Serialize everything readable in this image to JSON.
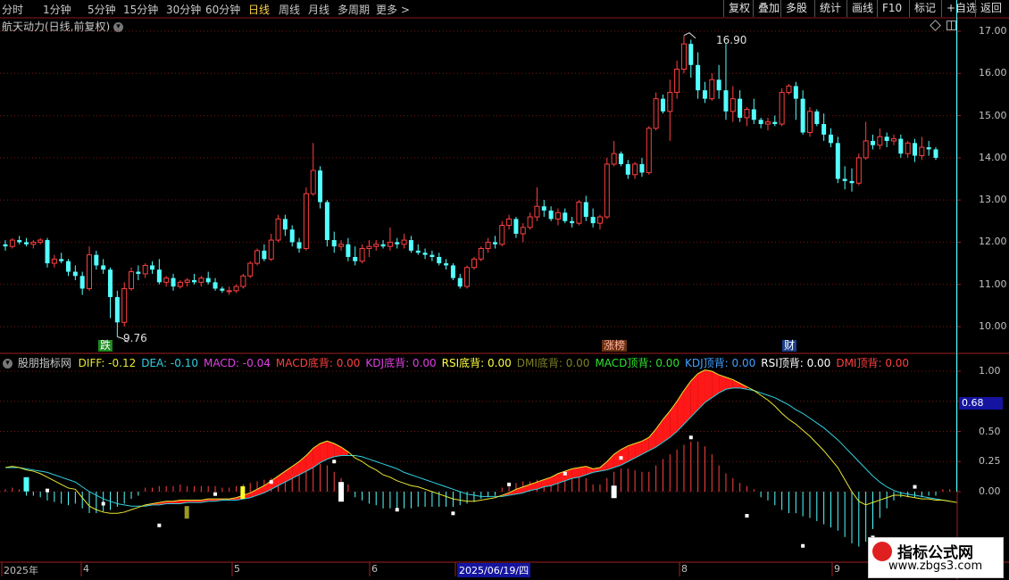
{
  "toolbar": {
    "periods": [
      "分时",
      "1分钟",
      "5分钟",
      "15分钟",
      "30分钟",
      "60分钟",
      "日线",
      "周线",
      "月线",
      "多周期",
      "更多 >"
    ],
    "active_period": "日线",
    "right_buttons": [
      "复权",
      "叠加",
      "多股",
      "统计",
      "画线",
      "F10",
      "标记",
      "+自选",
      "返回"
    ]
  },
  "title": "航天动力(日线,前复权)",
  "price_axis": [
    "17.00",
    "16.00",
    "15.00",
    "14.00",
    "13.00",
    "12.00",
    "11.00",
    "10.00"
  ],
  "high_label": "16.90",
  "low_label": "9.76",
  "markers": [
    {
      "text": "跌",
      "color": "#30c030"
    },
    {
      "text": "涨榜",
      "color": "#e03030"
    },
    {
      "text": "财",
      "color": "#4090ff"
    }
  ],
  "indicator": {
    "name": "股朋指标网",
    "values": [
      {
        "label": "DIFF:",
        "value": "-0.12",
        "color": "#e8e830"
      },
      {
        "label": "DEA:",
        "value": "-0.10",
        "color": "#30d0e0"
      },
      {
        "label": "MACD:",
        "value": "-0.04",
        "color": "#e040e0"
      },
      {
        "label": "MACD底背:",
        "value": "0.00",
        "color": "#ff4040"
      },
      {
        "label": "KDJ底背:",
        "value": "0.00",
        "color": "#e040e0"
      },
      {
        "label": "RSI底背:",
        "value": "0.00",
        "color": "#ffff40"
      },
      {
        "label": "DMI底背:",
        "value": "0.00",
        "color": "#808020"
      },
      {
        "label": "MACD顶背:",
        "value": "0.00",
        "color": "#30e030"
      },
      {
        "label": "KDJ顶背:",
        "value": "0.00",
        "color": "#40a0ff"
      },
      {
        "label": "RSI顶背:",
        "value": "0.00",
        "color": "#ffffff"
      },
      {
        "label": "DMI顶背:",
        "value": "0.00",
        "color": "#ff4040"
      }
    ]
  },
  "indicator_axis": [
    "1.00",
    "0.75",
    "0.50",
    "0.25",
    "0.00"
  ],
  "current_value": "0.68",
  "date_axis": [
    "2025年",
    "4",
    "5",
    "6",
    "2025/06/19/四",
    "8",
    "9"
  ],
  "watermark": {
    "title": "指标公式网",
    "url": "www.zbgs3.com"
  },
  "chart_data": {
    "type": "candlestick",
    "title": "航天动力(日线,前复权)",
    "ylim": [
      9.7,
      17.3
    ],
    "ohlc": [
      [
        11.95,
        12.05,
        11.8,
        11.9
      ],
      [
        11.9,
        12.1,
        11.85,
        12.05
      ],
      [
        12.05,
        12.15,
        11.95,
        12.0
      ],
      [
        12.0,
        12.1,
        11.9,
        11.95
      ],
      [
        11.95,
        12.05,
        11.85,
        12.0
      ],
      [
        12.0,
        12.1,
        11.95,
        12.05
      ],
      [
        12.05,
        12.1,
        11.4,
        11.5
      ],
      [
        11.5,
        11.7,
        11.4,
        11.6
      ],
      [
        11.6,
        11.75,
        11.5,
        11.55
      ],
      [
        11.55,
        11.6,
        11.2,
        11.3
      ],
      [
        11.3,
        11.45,
        11.1,
        11.2
      ],
      [
        11.2,
        11.3,
        10.75,
        10.9
      ],
      [
        10.9,
        11.9,
        10.85,
        11.7
      ],
      [
        11.7,
        11.8,
        11.35,
        11.45
      ],
      [
        11.45,
        11.6,
        11.25,
        11.35
      ],
      [
        11.35,
        11.4,
        10.2,
        10.7
      ],
      [
        10.7,
        10.85,
        9.76,
        10.1
      ],
      [
        10.1,
        11.05,
        10.0,
        10.9
      ],
      [
        10.9,
        11.4,
        10.85,
        11.3
      ],
      [
        11.3,
        11.45,
        11.1,
        11.25
      ],
      [
        11.25,
        11.5,
        11.15,
        11.45
      ],
      [
        11.45,
        11.55,
        11.25,
        11.35
      ],
      [
        11.35,
        11.6,
        11.0,
        11.05
      ],
      [
        11.05,
        11.2,
        10.95,
        11.15
      ],
      [
        11.15,
        11.25,
        10.85,
        10.95
      ],
      [
        10.95,
        11.1,
        10.9,
        11.05
      ],
      [
        11.05,
        11.15,
        10.95,
        11.1
      ],
      [
        11.1,
        11.25,
        11.0,
        11.05
      ],
      [
        11.05,
        11.2,
        10.95,
        11.15
      ],
      [
        11.15,
        11.3,
        11.0,
        11.05
      ],
      [
        11.05,
        11.15,
        10.85,
        10.9
      ],
      [
        10.9,
        10.95,
        10.8,
        10.85
      ],
      [
        10.85,
        10.95,
        10.75,
        10.85
      ],
      [
        10.85,
        11.0,
        10.8,
        10.95
      ],
      [
        10.95,
        11.25,
        10.9,
        11.2
      ],
      [
        11.2,
        11.55,
        11.15,
        11.5
      ],
      [
        11.5,
        11.85,
        11.45,
        11.8
      ],
      [
        11.8,
        11.95,
        11.55,
        11.6
      ],
      [
        11.6,
        12.2,
        11.55,
        12.05
      ],
      [
        12.05,
        12.65,
        12.0,
        12.55
      ],
      [
        12.55,
        12.65,
        12.15,
        12.3
      ],
      [
        12.3,
        12.4,
        11.9,
        12.0
      ],
      [
        12.0,
        12.1,
        11.75,
        11.85
      ],
      [
        11.85,
        13.3,
        11.8,
        13.15
      ],
      [
        13.15,
        14.35,
        13.1,
        13.7
      ],
      [
        13.7,
        13.8,
        12.8,
        12.95
      ],
      [
        12.95,
        13.0,
        11.9,
        12.05
      ],
      [
        12.05,
        12.25,
        11.75,
        11.9
      ],
      [
        11.9,
        12.05,
        11.8,
        11.95
      ],
      [
        11.95,
        12.1,
        11.55,
        11.65
      ],
      [
        11.65,
        11.9,
        11.45,
        11.55
      ],
      [
        11.55,
        11.95,
        11.5,
        11.85
      ],
      [
        11.85,
        12.05,
        11.65,
        11.9
      ],
      [
        11.9,
        12.05,
        11.8,
        11.95
      ],
      [
        11.95,
        12.05,
        11.85,
        11.9
      ],
      [
        11.9,
        12.35,
        11.8,
        12.0
      ],
      [
        12.0,
        12.1,
        11.85,
        11.95
      ],
      [
        11.95,
        12.2,
        11.85,
        12.05
      ],
      [
        12.05,
        12.15,
        11.75,
        11.8
      ],
      [
        11.8,
        11.95,
        11.7,
        11.75
      ],
      [
        11.75,
        11.85,
        11.6,
        11.7
      ],
      [
        11.7,
        11.8,
        11.55,
        11.65
      ],
      [
        11.65,
        11.75,
        11.45,
        11.5
      ],
      [
        11.5,
        11.6,
        11.35,
        11.45
      ],
      [
        11.45,
        11.5,
        11.1,
        11.15
      ],
      [
        11.15,
        11.25,
        10.9,
        10.95
      ],
      [
        10.95,
        11.45,
        10.9,
        11.4
      ],
      [
        11.4,
        11.65,
        11.35,
        11.6
      ],
      [
        11.6,
        11.9,
        11.55,
        11.85
      ],
      [
        11.85,
        12.1,
        11.75,
        12.0
      ],
      [
        12.0,
        12.15,
        11.85,
        11.95
      ],
      [
        11.95,
        12.5,
        11.9,
        12.4
      ],
      [
        12.4,
        12.65,
        12.3,
        12.55
      ],
      [
        12.55,
        12.6,
        12.1,
        12.2
      ],
      [
        12.2,
        12.45,
        12.0,
        12.35
      ],
      [
        12.35,
        12.7,
        12.3,
        12.6
      ],
      [
        12.6,
        13.3,
        12.5,
        12.85
      ],
      [
        12.85,
        13.0,
        12.6,
        12.75
      ],
      [
        12.75,
        12.85,
        12.5,
        12.55
      ],
      [
        12.55,
        12.8,
        12.4,
        12.7
      ],
      [
        12.7,
        12.8,
        12.45,
        12.5
      ],
      [
        12.5,
        12.6,
        12.35,
        12.45
      ],
      [
        12.45,
        13.0,
        12.4,
        12.95
      ],
      [
        12.95,
        13.1,
        12.5,
        12.6
      ],
      [
        12.6,
        12.8,
        12.35,
        12.45
      ],
      [
        12.45,
        12.65,
        12.3,
        12.6
      ],
      [
        12.6,
        14.0,
        12.55,
        13.85
      ],
      [
        13.85,
        14.4,
        13.8,
        14.1
      ],
      [
        14.1,
        14.15,
        13.8,
        13.85
      ],
      [
        13.85,
        13.95,
        13.5,
        13.6
      ],
      [
        13.6,
        13.9,
        13.5,
        13.85
      ],
      [
        13.85,
        14.0,
        13.55,
        13.65
      ],
      [
        13.65,
        14.75,
        13.6,
        14.7
      ],
      [
        14.7,
        15.55,
        14.65,
        15.4
      ],
      [
        15.4,
        15.5,
        15.05,
        15.1
      ],
      [
        15.1,
        15.85,
        14.4,
        15.55
      ],
      [
        15.55,
        16.3,
        15.4,
        16.1
      ],
      [
        16.1,
        16.9,
        16.0,
        16.7
      ],
      [
        16.7,
        16.8,
        15.9,
        16.2
      ],
      [
        16.2,
        16.5,
        15.4,
        15.6
      ],
      [
        15.6,
        15.8,
        15.3,
        15.4
      ],
      [
        15.4,
        16.0,
        15.35,
        15.85
      ],
      [
        15.85,
        16.2,
        15.4,
        15.6
      ],
      [
        15.6,
        16.7,
        14.9,
        15.1
      ],
      [
        15.1,
        15.7,
        14.85,
        15.4
      ],
      [
        15.4,
        15.6,
        14.85,
        14.95
      ],
      [
        14.95,
        15.2,
        14.75,
        15.15
      ],
      [
        15.15,
        15.4,
        14.8,
        14.9
      ],
      [
        14.9,
        14.95,
        14.7,
        14.8
      ],
      [
        14.8,
        14.95,
        14.65,
        14.85
      ],
      [
        14.85,
        15.0,
        14.75,
        14.8
      ],
      [
        14.8,
        15.65,
        14.75,
        15.55
      ],
      [
        15.55,
        15.75,
        15.5,
        15.7
      ],
      [
        15.7,
        15.8,
        14.9,
        15.4
      ],
      [
        15.4,
        15.6,
        14.55,
        14.6
      ],
      [
        14.6,
        15.2,
        14.5,
        15.1
      ],
      [
        15.1,
        15.15,
        14.75,
        14.8
      ],
      [
        14.8,
        15.05,
        14.4,
        14.55
      ],
      [
        14.55,
        14.7,
        14.25,
        14.35
      ],
      [
        14.35,
        14.5,
        13.4,
        13.5
      ],
      [
        13.5,
        13.8,
        13.25,
        13.45
      ],
      [
        13.45,
        13.75,
        13.2,
        13.4
      ],
      [
        13.4,
        14.1,
        13.35,
        14.0
      ],
      [
        14.0,
        14.85,
        13.95,
        14.4
      ],
      [
        14.4,
        14.55,
        14.2,
        14.3
      ],
      [
        14.3,
        14.7,
        14.2,
        14.5
      ],
      [
        14.5,
        14.6,
        14.25,
        14.4
      ],
      [
        14.4,
        14.55,
        14.3,
        14.45
      ],
      [
        14.45,
        14.55,
        14.0,
        14.1
      ],
      [
        14.1,
        14.4,
        14.0,
        14.35
      ],
      [
        14.35,
        14.45,
        13.9,
        14.05
      ],
      [
        14.05,
        14.5,
        13.95,
        14.25
      ],
      [
        14.25,
        14.4,
        14.05,
        14.2
      ],
      [
        14.2,
        14.25,
        13.95,
        14.0
      ]
    ],
    "macd": {
      "ylim": [
        -0.55,
        1.15
      ],
      "diff": [
        0.2,
        0.21,
        0.2,
        0.18,
        0.17,
        0.15,
        0.12,
        0.09,
        0.06,
        0.03,
        0.02,
        -0.05,
        -0.12,
        -0.15,
        -0.17,
        -0.18,
        -0.18,
        -0.17,
        -0.15,
        -0.13,
        -0.11,
        -0.1,
        -0.09,
        -0.08,
        -0.08,
        -0.07,
        -0.07,
        -0.07,
        -0.07,
        -0.06,
        -0.06,
        -0.06,
        -0.06,
        -0.05,
        -0.03,
        -0.01,
        0.02,
        0.05,
        0.09,
        0.13,
        0.17,
        0.21,
        0.25,
        0.3,
        0.36,
        0.4,
        0.42,
        0.4,
        0.37,
        0.33,
        0.28,
        0.25,
        0.21,
        0.18,
        0.14,
        0.12,
        0.09,
        0.07,
        0.05,
        0.04,
        0.02,
        0.0,
        -0.02,
        -0.04,
        -0.06,
        -0.07,
        -0.08,
        -0.08,
        -0.07,
        -0.06,
        -0.05,
        -0.03,
        -0.01,
        0.02,
        0.04,
        0.06,
        0.08,
        0.1,
        0.12,
        0.15,
        0.17,
        0.19,
        0.2,
        0.21,
        0.19,
        0.2,
        0.25,
        0.31,
        0.35,
        0.38,
        0.4,
        0.42,
        0.45,
        0.52,
        0.6,
        0.67,
        0.75,
        0.84,
        0.92,
        0.98,
        1.01,
        1.0,
        0.97,
        0.95,
        0.93,
        0.9,
        0.87,
        0.84,
        0.8,
        0.76,
        0.71,
        0.65,
        0.6,
        0.56,
        0.51,
        0.46,
        0.4,
        0.34,
        0.27,
        0.2,
        0.1,
        0.0,
        -0.08,
        -0.11,
        -0.09,
        -0.07,
        -0.05,
        -0.03,
        -0.03,
        -0.04,
        -0.05,
        -0.06,
        -0.06,
        -0.07,
        -0.07,
        -0.08,
        -0.09
      ],
      "dea": [
        0.2,
        0.2,
        0.2,
        0.19,
        0.18,
        0.17,
        0.16,
        0.14,
        0.12,
        0.1,
        0.08,
        0.04,
        0.0,
        -0.03,
        -0.06,
        -0.08,
        -0.1,
        -0.11,
        -0.12,
        -0.12,
        -0.12,
        -0.11,
        -0.11,
        -0.1,
        -0.1,
        -0.1,
        -0.09,
        -0.09,
        -0.09,
        -0.08,
        -0.08,
        -0.07,
        -0.07,
        -0.07,
        -0.06,
        -0.05,
        -0.03,
        -0.01,
        0.02,
        0.05,
        0.08,
        0.11,
        0.14,
        0.17,
        0.2,
        0.24,
        0.27,
        0.29,
        0.3,
        0.3,
        0.3,
        0.29,
        0.27,
        0.25,
        0.23,
        0.21,
        0.19,
        0.16,
        0.14,
        0.12,
        0.1,
        0.08,
        0.06,
        0.04,
        0.02,
        0.0,
        -0.02,
        -0.03,
        -0.04,
        -0.04,
        -0.04,
        -0.04,
        -0.03,
        -0.02,
        -0.01,
        0.01,
        0.02,
        0.04,
        0.05,
        0.07,
        0.09,
        0.11,
        0.12,
        0.14,
        0.16,
        0.17,
        0.18,
        0.2,
        0.22,
        0.25,
        0.28,
        0.31,
        0.34,
        0.37,
        0.41,
        0.45,
        0.5,
        0.56,
        0.62,
        0.68,
        0.74,
        0.78,
        0.82,
        0.85,
        0.86,
        0.86,
        0.85,
        0.84,
        0.82,
        0.8,
        0.78,
        0.75,
        0.72,
        0.68,
        0.65,
        0.61,
        0.57,
        0.53,
        0.48,
        0.43,
        0.37,
        0.31,
        0.25,
        0.19,
        0.13,
        0.08,
        0.04,
        0.01,
        -0.01,
        -0.02,
        -0.03,
        -0.04,
        -0.05,
        -0.06,
        -0.07,
        -0.08
      ]
    }
  }
}
